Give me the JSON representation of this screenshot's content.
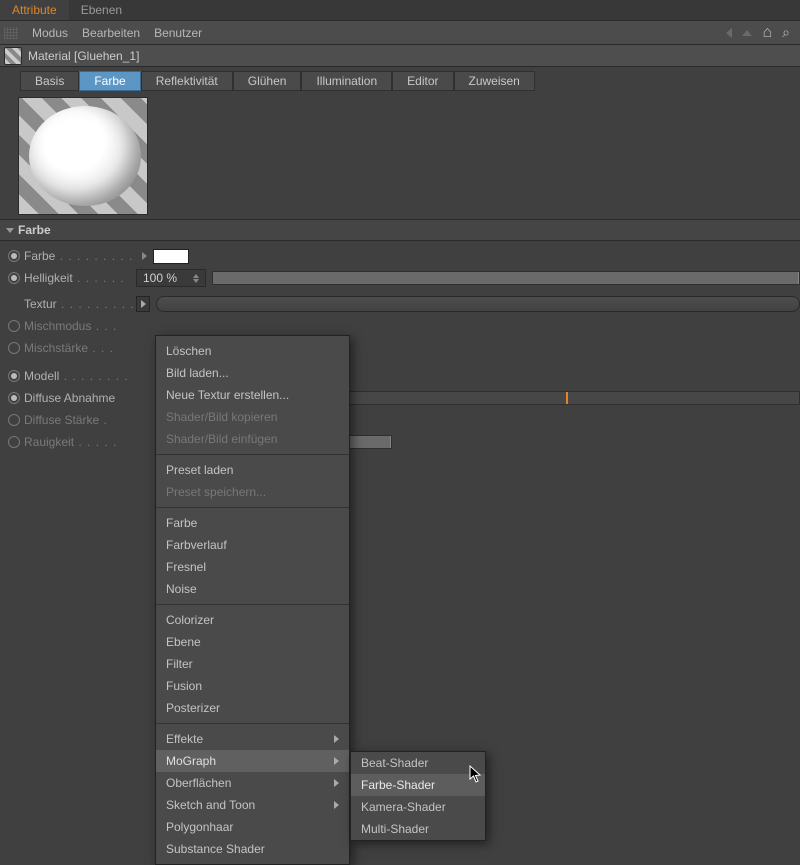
{
  "tabs": {
    "attribute": "Attribute",
    "ebenen": "Ebenen"
  },
  "menus": {
    "modus": "Modus",
    "bearbeiten": "Bearbeiten",
    "benutzer": "Benutzer"
  },
  "title": "Material [Gluehen_1]",
  "subtabs": {
    "basis": "Basis",
    "farbe": "Farbe",
    "reflekt": "Reflektivität",
    "gluehen": "Glühen",
    "illum": "Illumination",
    "editor": "Editor",
    "zuweisen": "Zuweisen"
  },
  "section": "Farbe",
  "params": {
    "farbe": "Farbe",
    "helligkeit": "Helligkeit",
    "helligkeit_val": "100 %",
    "textur": "Textur",
    "mischmodus": "Mischmodus",
    "mischstaerke": "Mischstärke",
    "modell": "Modell",
    "diffuse_abnahme": "Diffuse Abnahme",
    "diffuse_staerke": "Diffuse Stärke",
    "rauigkeit": "Rauigkeit"
  },
  "ctx": {
    "loeschen": "Löschen",
    "bild_laden": "Bild laden...",
    "neue_textur": "Neue Textur erstellen...",
    "shader_kopieren": "Shader/Bild kopieren",
    "shader_einfuegen": "Shader/Bild einfügen",
    "preset_laden": "Preset laden",
    "preset_speichern": "Preset speichern...",
    "farbe": "Farbe",
    "farbverlauf": "Farbverlauf",
    "fresnel": "Fresnel",
    "noise": "Noise",
    "colorizer": "Colorizer",
    "ebene": "Ebene",
    "filter": "Filter",
    "fusion": "Fusion",
    "posterizer": "Posterizer",
    "effekte": "Effekte",
    "mograph": "MoGraph",
    "oberflaechen": "Oberflächen",
    "sketch": "Sketch and Toon",
    "polygonhaar": "Polygonhaar",
    "substance": "Substance Shader"
  },
  "submenu": {
    "beat": "Beat-Shader",
    "farbe": "Farbe-Shader",
    "kamera": "Kamera-Shader",
    "multi": "Multi-Shader"
  }
}
